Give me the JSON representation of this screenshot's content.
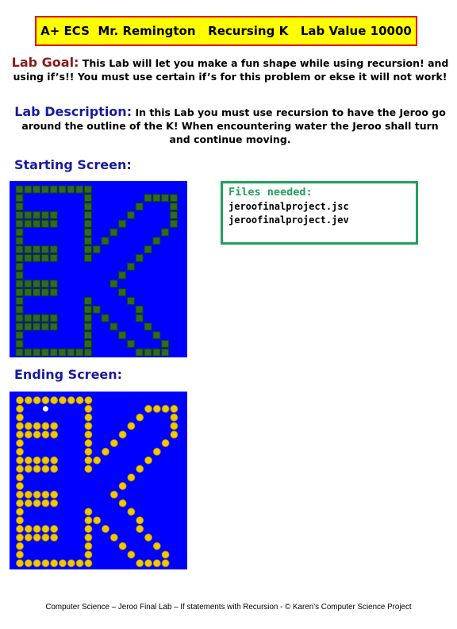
{
  "title": "A+ ECS  Mr. Remington   Recursing K   Lab Value 10000",
  "goal": {
    "label": "Lab Goal:",
    "text": " This Lab will let you make a fun shape while using recursion! and using if’s!! You must use certain if’s for this problem or ekse it will not work!"
  },
  "description": {
    "label": "Lab Description:",
    "text": " In this Lab you must use recursion to have the Jeroo go around the outline of the K! When encountering water the Jeroo shall turn and continue moving."
  },
  "starting_screen": {
    "heading": "Starting Screen:",
    "board": {
      "background": "#0000ff",
      "tile": "net",
      "tile_color": "#2e6b1f"
    }
  },
  "ending_screen": {
    "heading": "Ending Screen:",
    "board": {
      "background": "#0000ff",
      "tile": "flower",
      "tile_color": "#f0c800"
    }
  },
  "files": {
    "heading": "Files needed:",
    "items": [
      "jeroofinalproject.jsc",
      "jeroofinalproject.jev"
    ]
  },
  "footer": "Computer Science – Jeroo Final Lab – If statements with Recursion - © Karen’s Computer Science Project",
  "colors": {
    "title_bg": "#ffff00",
    "title_border": "#e8001e",
    "goal_label": "#8b1a1a",
    "heading_blue": "#1a1aa0",
    "files_green": "#22a05a",
    "water": "#0000ff"
  }
}
